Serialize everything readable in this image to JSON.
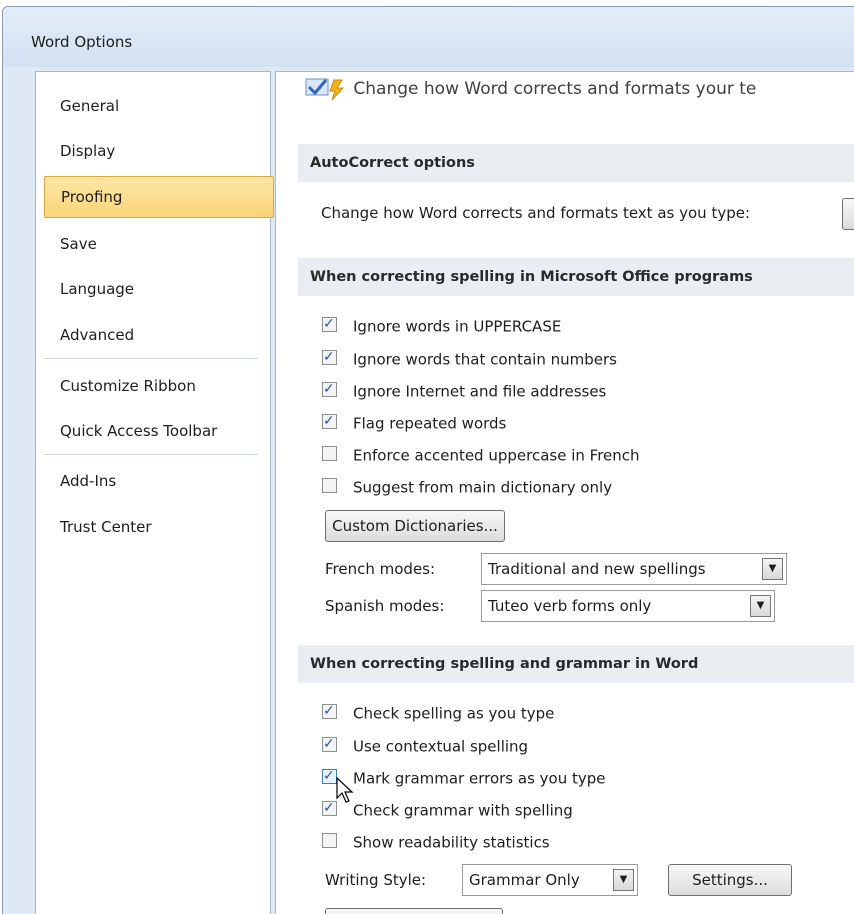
{
  "window": {
    "title": "Word Options"
  },
  "sidebar": {
    "items": [
      {
        "label": "General"
      },
      {
        "label": "Display"
      },
      {
        "label": "Proofing"
      },
      {
        "label": "Save"
      },
      {
        "label": "Language"
      },
      {
        "label": "Advanced"
      },
      {
        "label": "Customize Ribbon"
      },
      {
        "label": "Quick Access Toolbar"
      },
      {
        "label": "Add-Ins"
      },
      {
        "label": "Trust Center"
      }
    ],
    "selected": "Proofing"
  },
  "header": {
    "text": "Change how Word corrects and formats your te",
    "icon": "proofing-check-icon"
  },
  "autocorrect": {
    "heading": "AutoCorrect options",
    "text": "Change how Word corrects and formats text as you type:"
  },
  "office": {
    "heading": "When correcting spelling in Microsoft Office programs",
    "options": [
      {
        "label": "Ignore words in UPPERCASE",
        "checked": true
      },
      {
        "label": "Ignore words that contain numbers",
        "checked": true
      },
      {
        "label": "Ignore Internet and file addresses",
        "checked": true
      },
      {
        "label": "Flag repeated words",
        "checked": true
      },
      {
        "label": "Enforce accented uppercase in French",
        "checked": false
      },
      {
        "label": "Suggest from main dictionary only",
        "checked": false
      }
    ],
    "custom_dictionaries": "Custom Dictionaries...",
    "french_label": "French modes:",
    "french_value": "Traditional and new spellings",
    "spanish_label": "Spanish modes:",
    "spanish_value": "Tuteo verb forms only"
  },
  "word": {
    "heading": "When correcting spelling and grammar in Word",
    "options": [
      {
        "label": "Check spelling as you type",
        "checked": true
      },
      {
        "label": "Use contextual spelling",
        "checked": true
      },
      {
        "label": "Mark grammar errors as you type",
        "checked": true
      },
      {
        "label": "Check grammar with spelling",
        "checked": true
      },
      {
        "label": "Show readability statistics",
        "checked": false
      }
    ],
    "writing_style_label": "Writing Style:",
    "writing_style_value": "Grammar Only",
    "settings_button": "Settings..."
  },
  "colors": {
    "selected_bg": "#fbd478",
    "section_bg": "#eaedf1",
    "check": "#2b57a8"
  }
}
